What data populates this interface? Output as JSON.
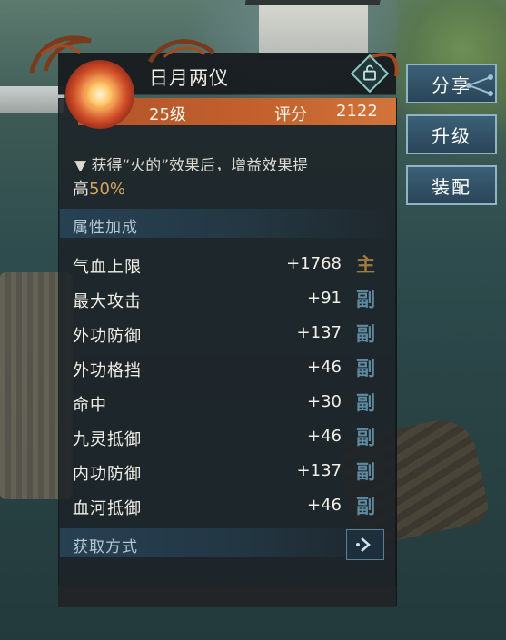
{
  "item": {
    "name": "日月两仪",
    "level": "25级",
    "score_label": "评分",
    "score_value": "2122"
  },
  "description": {
    "line1": "▼ 获得“火的”效果后，增益效果提",
    "line2_prefix": "高",
    "line2_highlight": "50%"
  },
  "sections": {
    "attributes_title": "属性加成",
    "source_title": "获取方式"
  },
  "attributes": [
    {
      "name": "气血上限",
      "value": "+1768",
      "tag": "主",
      "kind": "main"
    },
    {
      "name": "最大攻击",
      "value": "+91",
      "tag": "副",
      "kind": "sub"
    },
    {
      "name": "外功防御",
      "value": "+137",
      "tag": "副",
      "kind": "sub"
    },
    {
      "name": "外功格挡",
      "value": "+46",
      "tag": "副",
      "kind": "sub"
    },
    {
      "name": "命中",
      "value": "+30",
      "tag": "副",
      "kind": "sub"
    },
    {
      "name": "九灵抵御",
      "value": "+46",
      "tag": "副",
      "kind": "sub"
    },
    {
      "name": "内功防御",
      "value": "+137",
      "tag": "副",
      "kind": "sub"
    },
    {
      "name": "血河抵御",
      "value": "+46",
      "tag": "副",
      "kind": "sub"
    }
  ],
  "buttons": {
    "share": "分享",
    "upgrade": "升级",
    "equip": "装配"
  },
  "icons": {
    "gem": "gem-icon",
    "lock": "unlock-icon",
    "share": "share-icon",
    "source_arrow": "arrow-right-icon"
  },
  "colors": {
    "header_bar": "#c4622d",
    "highlight": "#d4a45c",
    "main_tag": "#a07a3e",
    "sub_tag": "#5f8aa1",
    "button_border": "#8fb3c7"
  }
}
